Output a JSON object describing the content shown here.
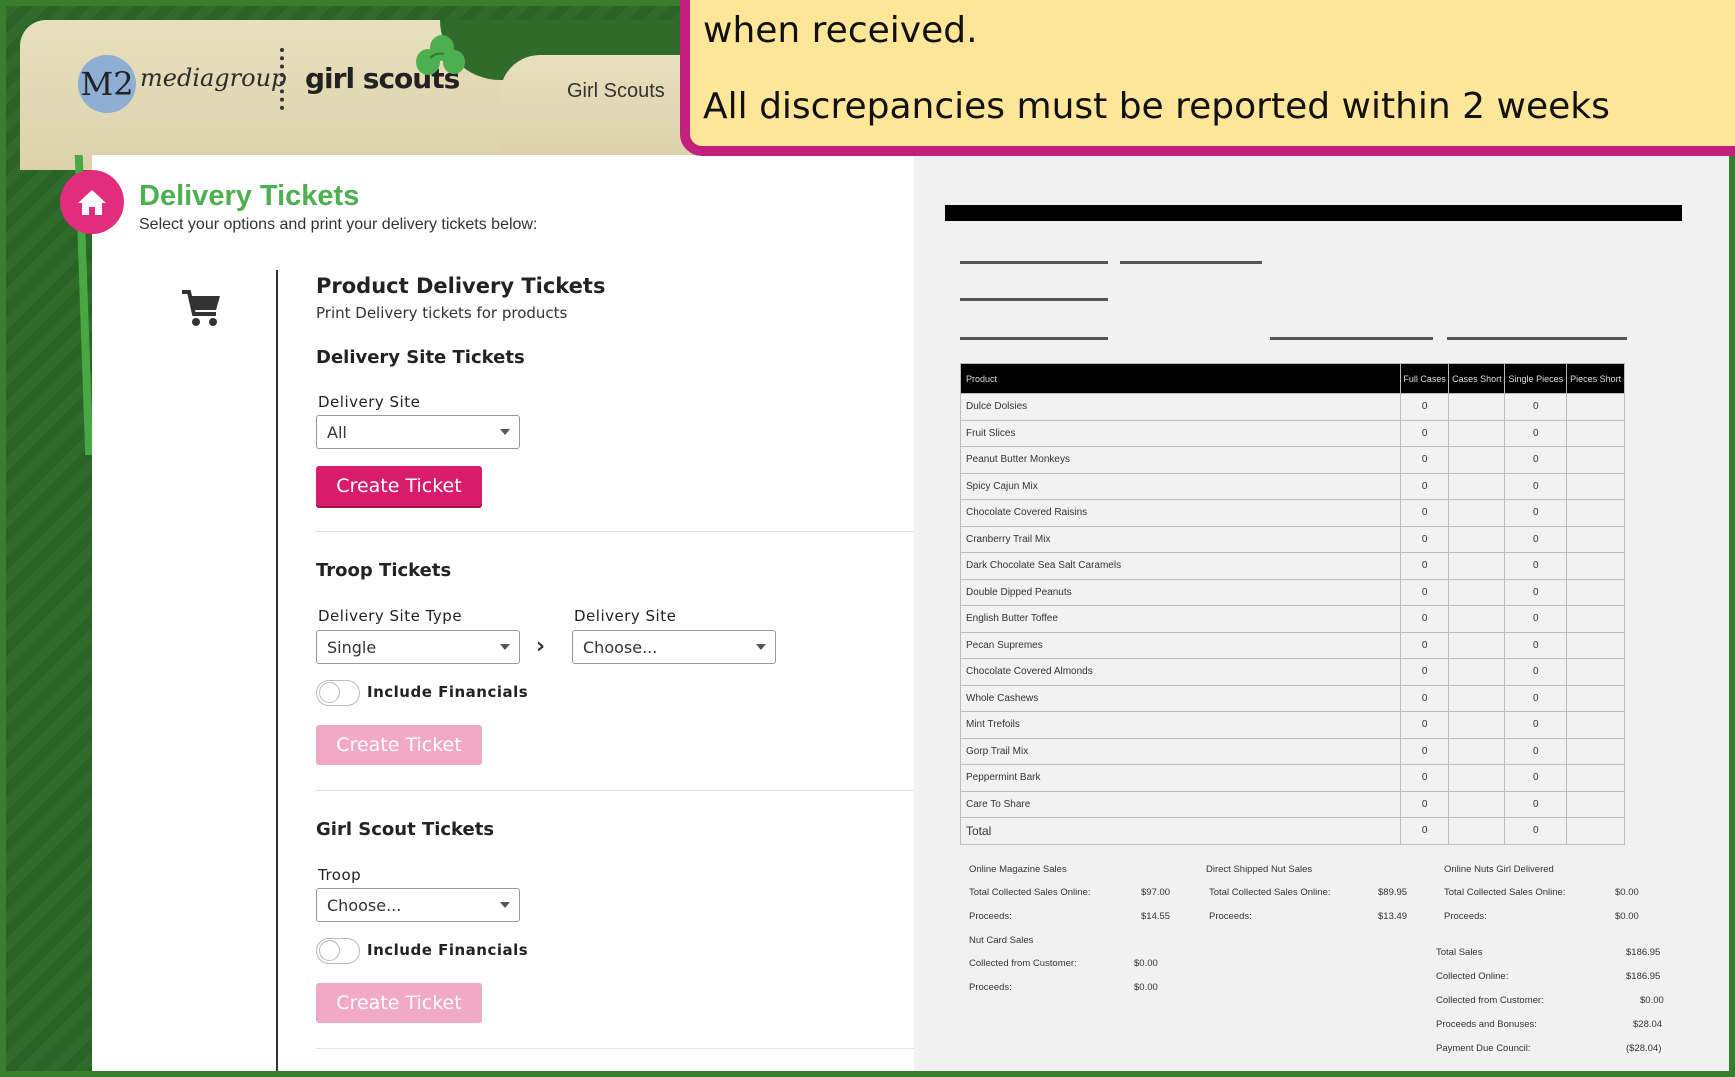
{
  "header": {
    "m2_logo": "M2",
    "mediagroup_text": "mediagroup",
    "girlscouts_logo": "girl scouts",
    "tab_label": "Girl Scouts"
  },
  "callout": {
    "line1": "when received.",
    "line2": "All discrepancies must be reported within 2 weeks"
  },
  "page": {
    "title": "Delivery Tickets",
    "subtitle": "Select your options and print your delivery tickets below:"
  },
  "product_section": {
    "title": "Product Delivery Tickets",
    "subtitle": "Print Delivery tickets for products"
  },
  "delivery_site_tickets": {
    "title": "Delivery Site Tickets",
    "site_label": "Delivery Site",
    "site_value": "All",
    "button": "Create Ticket"
  },
  "troop_tickets": {
    "title": "Troop Tickets",
    "type_label": "Delivery Site Type",
    "type_value": "Single",
    "site_label": "Delivery Site",
    "site_value": "Choose...",
    "include_financials": "Include Financials",
    "button": "Create Ticket"
  },
  "girl_scout_tickets": {
    "title": "Girl Scout Tickets",
    "troop_label": "Troop",
    "troop_value": "Choose...",
    "include_financials": "Include Financials",
    "button": "Create Ticket"
  },
  "document": {
    "columns": [
      "Product",
      "Full Cases",
      "Cases Short",
      "Single Pieces",
      "Pieces Short"
    ],
    "rows": [
      [
        "Dulce Dolsies",
        "0",
        "",
        "0",
        ""
      ],
      [
        "Fruit Slices",
        "0",
        "",
        "0",
        ""
      ],
      [
        "Peanut Butter Monkeys",
        "0",
        "",
        "0",
        ""
      ],
      [
        "Spicy Cajun Mix",
        "0",
        "",
        "0",
        ""
      ],
      [
        "Chocolate Covered Raisins",
        "0",
        "",
        "0",
        ""
      ],
      [
        "Cranberry Trail Mix",
        "0",
        "",
        "0",
        ""
      ],
      [
        "Dark Chocolate Sea Salt Caramels",
        "0",
        "",
        "0",
        ""
      ],
      [
        "Double Dipped Peanuts",
        "0",
        "",
        "0",
        ""
      ],
      [
        "English Butter Toffee",
        "0",
        "",
        "0",
        ""
      ],
      [
        "Pecan Supremes",
        "0",
        "",
        "0",
        ""
      ],
      [
        "Chocolate Covered Almonds",
        "0",
        "",
        "0",
        ""
      ],
      [
        "Whole Cashews",
        "0",
        "",
        "0",
        ""
      ],
      [
        "Mint Trefoils",
        "0",
        "",
        "0",
        ""
      ],
      [
        "Gorp Trail Mix",
        "0",
        "",
        "0",
        ""
      ],
      [
        "Peppermint Bark",
        "0",
        "",
        "0",
        ""
      ],
      [
        "Care To Share",
        "0",
        "",
        "0",
        ""
      ],
      [
        "Total",
        "0",
        "",
        "0",
        ""
      ]
    ],
    "summary": {
      "online_mag_title": "Online Magazine Sales",
      "online_mag_collected_label": "Total Collected Sales Online:",
      "online_mag_collected_value": "$97.00",
      "online_mag_proceeds_label": "Proceeds:",
      "online_mag_proceeds_value": "$14.55",
      "direct_title": "Direct Shipped Nut Sales",
      "direct_collected_label": "Total Collected Sales Online:",
      "direct_collected_value": "$89.95",
      "direct_proceeds_label": "Proceeds:",
      "direct_proceeds_value": "$13.49",
      "girl_delivered_title": "Online Nuts Girl Delivered",
      "girl_delivered_collected_label": "Total Collected Sales Online:",
      "girl_delivered_collected_value": "$0.00",
      "girl_delivered_proceeds_label": "Proceeds:",
      "girl_delivered_proceeds_value": "$0.00",
      "nut_card_title": "Nut Card Sales",
      "nut_card_collected_label": "Collected from Customer:",
      "nut_card_collected_value": "$0.00",
      "nut_card_proceeds_label": "Proceeds:",
      "nut_card_proceeds_value": "$0.00",
      "total_sales_label": "Total Sales",
      "total_sales_value": "$186.95",
      "collected_online_label": "Collected Online:",
      "collected_online_value": "$186.95",
      "collected_customer_label": "Collected from Customer:",
      "collected_customer_value": "$0.00",
      "proceeds_bonuses_label": "Proceeds and Bonuses:",
      "proceeds_bonuses_value": "$28.04",
      "payment_due_label": "Payment Due Council:",
      "payment_due_value": "($28.04)"
    }
  }
}
